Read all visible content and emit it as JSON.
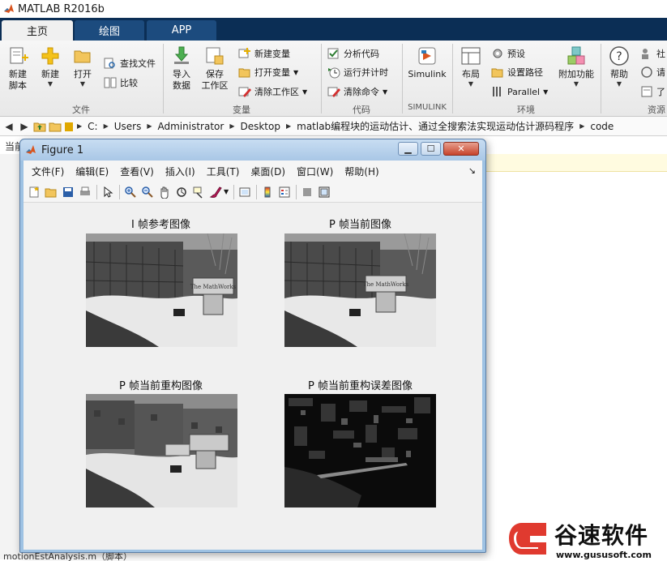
{
  "window": {
    "title": "MATLAB R2016b"
  },
  "tabs": [
    {
      "label": "主页",
      "active": true
    },
    {
      "label": "绘图",
      "active": false
    },
    {
      "label": "APP",
      "active": false
    }
  ],
  "ribbon": {
    "file": {
      "group_label": "文件",
      "new_script": "新建\n脚本",
      "new": "新建",
      "open": "打开",
      "find_files": "查找文件",
      "compare": "比较"
    },
    "variable": {
      "group_label": "变量",
      "import": "导入\n数据",
      "save_workspace": "保存\n工作区",
      "new_variable": "新建变量",
      "open_variable": "打开变量",
      "clear_workspace": "清除工作区"
    },
    "code": {
      "group_label": "代码",
      "analyze": "分析代码",
      "run_time": "运行并计时",
      "clear_commands": "清除命令"
    },
    "simulink": {
      "group_label": "SIMULINK",
      "label": "Simulink"
    },
    "environment": {
      "group_label": "环境",
      "layout": "布局",
      "preferences": "预设",
      "set_path": "设置路径",
      "parallel": "Parallel",
      "addons": "附加功能"
    },
    "resources": {
      "group_label": "资源",
      "help": "帮助",
      "community": "社",
      "request": "请",
      "learn": "了"
    }
  },
  "address": {
    "crumbs": [
      "C:",
      "Users",
      "Administrator",
      "Desktop",
      "matlab编程块的运动估计、通过全搜索法实现运动估计源码程序",
      "code"
    ]
  },
  "current_folder_label": "当前",
  "bottom_file": "motionEstAnalysis.m（脚本）",
  "figure": {
    "title": "Figure 1",
    "menus": [
      "文件(F)",
      "编辑(E)",
      "查看(V)",
      "插入(I)",
      "工具(T)",
      "桌面(D)",
      "窗口(W)",
      "帮助(H)"
    ],
    "subplots": [
      {
        "title": "I 帧参考图像"
      },
      {
        "title": "P 帧当前图像"
      },
      {
        "title": "P 帧当前重构图像"
      },
      {
        "title": "P 帧当前重构误差图像"
      }
    ]
  },
  "watermark": {
    "text": "谷速软件",
    "url": "www.gususoft.com"
  },
  "colors": {
    "tabbar": "#0b2e55",
    "figure_frame": "#9ec2e3",
    "canvas": "#f0f0f0",
    "watermark_red": "#e03a2f"
  }
}
